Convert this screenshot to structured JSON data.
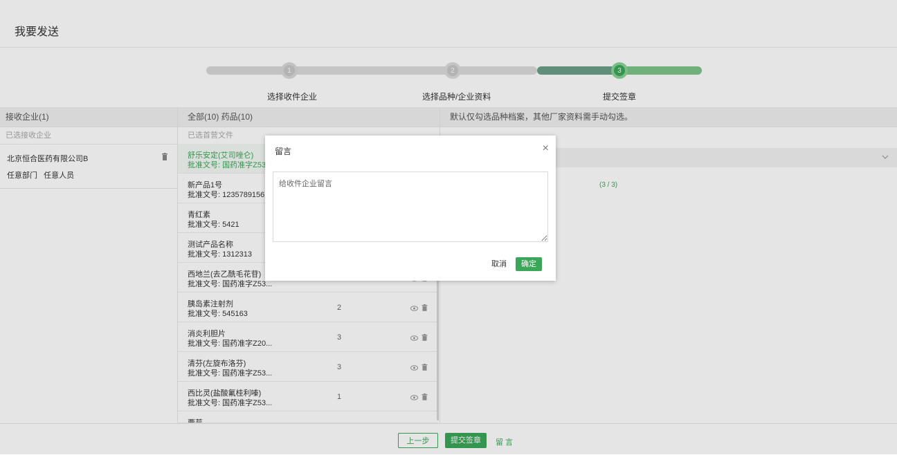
{
  "header": {
    "title": "我要发送"
  },
  "steps": [
    {
      "number": "1",
      "label": "选择收件企业"
    },
    {
      "number": "2",
      "label": "选择品种/企业资料"
    },
    {
      "number": "3",
      "label": "提交签章"
    }
  ],
  "colors": {
    "accent": "#3aa657",
    "step_active": "#6aa08a",
    "step_inactive": "#d8d8d8"
  },
  "left": {
    "header": "接收企业(1)",
    "sub": "已选接收企业",
    "companies": [
      {
        "name": "北京恒合医药有限公司B",
        "dept": "任意部门",
        "person": "任意人员"
      }
    ]
  },
  "middle": {
    "header": "全部(10)  药品(10)",
    "sub": "已选首营文件",
    "drugs": [
      {
        "name": "舒乐安定(艾司唑仑)",
        "approval": "批准文号: 国药准字Z53...",
        "count": "",
        "selected": true
      },
      {
        "name": "新产品1号",
        "approval": "批准文号: 1235789156...",
        "count": ""
      },
      {
        "name": "青红素",
        "approval": "批准文号: 5421",
        "count": ""
      },
      {
        "name": "测试产品名称",
        "approval": "批准文号: 1312313",
        "count": ""
      },
      {
        "name": "西地兰(去乙酰毛花苷)",
        "approval": "批准文号: 国药准字Z53...",
        "count": "2"
      },
      {
        "name": "胰岛素注射剂",
        "approval": "批准文号: 545163",
        "count": "2"
      },
      {
        "name": "消炎利胆片",
        "approval": "批准文号: 国药准字Z20...",
        "count": "3"
      },
      {
        "name": "清芬(左旋布洛芬)",
        "approval": "批准文号: 国药准字Z53...",
        "count": "3"
      },
      {
        "name": "西比灵(盐酸氟桂利嗪)",
        "approval": "批准文号: 国药准字Z53...",
        "count": "1"
      },
      {
        "name": "栗蕊",
        "approval": "",
        "count": ""
      }
    ]
  },
  "right": {
    "header": "默认仅勾选品种档案，其他厂家资料需手动勾选。",
    "count": "(3 / 3)"
  },
  "footer": {
    "prev": "上一步",
    "submit": "提交签章",
    "message": "留言"
  },
  "modal": {
    "title": "留言",
    "placeholder": "给收件企业留言",
    "cancel": "取消",
    "confirm": "确定"
  }
}
